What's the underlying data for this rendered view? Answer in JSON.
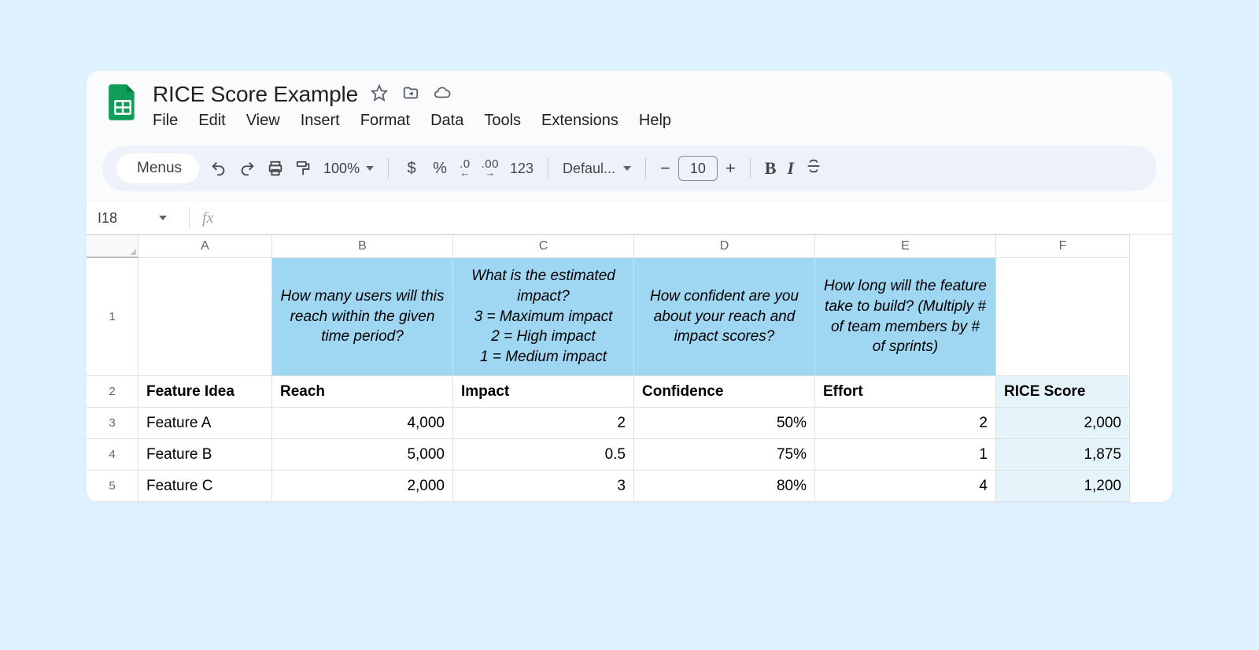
{
  "doc": {
    "title": "RICE Score Example"
  },
  "menu": [
    "File",
    "Edit",
    "View",
    "Insert",
    "Format",
    "Data",
    "Tools",
    "Extensions",
    "Help"
  ],
  "toolbar": {
    "menus_label": "Menus",
    "zoom": "100%",
    "currency": "$",
    "percent": "%",
    "dec_decimal": ".0",
    "inc_decimal": ".00",
    "numfmt": "123",
    "font_name": "Defaul...",
    "font_size": "10"
  },
  "namebox": "I18",
  "columns": [
    "A",
    "B",
    "C",
    "D",
    "E",
    "F"
  ],
  "rows": [
    "1",
    "2",
    "3",
    "4",
    "5"
  ],
  "descriptions": {
    "B": "How many users will this reach within the given time period?",
    "C": "What is the estimated impact?\n3 = Maximum impact\n2 = High impact\n1 = Medium impact",
    "D": "How confident are you about your reach and impact scores?",
    "E": "How long will the feature take to build? (Multiply # of team members by # of sprints)"
  },
  "headers": {
    "A": "Feature Idea",
    "B": "Reach",
    "C": "Impact",
    "D": "Confidence",
    "E": "Effort",
    "F": "RICE Score"
  },
  "data": [
    {
      "A": "Feature A",
      "B": "4,000",
      "C": "2",
      "D": "50%",
      "E": "2",
      "F": "2,000"
    },
    {
      "A": "Feature B",
      "B": "5,000",
      "C": "0.5",
      "D": "75%",
      "E": "1",
      "F": "1,875"
    },
    {
      "A": "Feature C",
      "B": "2,000",
      "C": "3",
      "D": "80%",
      "E": "4",
      "F": "1,200"
    }
  ],
  "chart_data": {
    "type": "table",
    "columns": [
      "Feature Idea",
      "Reach",
      "Impact",
      "Confidence",
      "Effort",
      "RICE Score"
    ],
    "rows": [
      [
        "Feature A",
        4000,
        2,
        0.5,
        2,
        2000
      ],
      [
        "Feature B",
        5000,
        0.5,
        0.75,
        1,
        1875
      ],
      [
        "Feature C",
        2000,
        3,
        0.8,
        4,
        1200
      ]
    ]
  }
}
